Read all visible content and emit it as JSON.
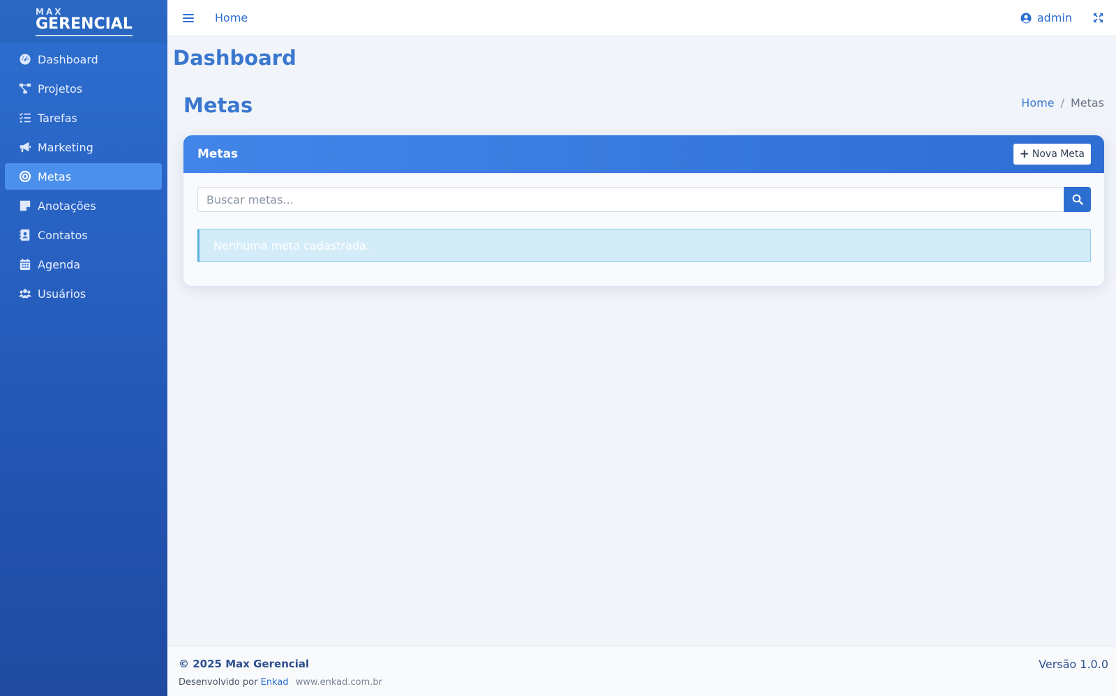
{
  "brand": {
    "top": "MAX",
    "main": "GERENCIAL"
  },
  "sidebar": {
    "items": [
      {
        "label": "Dashboard",
        "icon": "dashboard-gauge-icon"
      },
      {
        "label": "Projetos",
        "icon": "project-diagram-icon"
      },
      {
        "label": "Tarefas",
        "icon": "tasks-list-icon"
      },
      {
        "label": "Marketing",
        "icon": "bullhorn-icon"
      },
      {
        "label": "Metas",
        "icon": "target-icon",
        "active": true
      },
      {
        "label": "Anotações",
        "icon": "sticky-note-icon"
      },
      {
        "label": "Contatos",
        "icon": "address-book-icon"
      },
      {
        "label": "Agenda",
        "icon": "calendar-icon"
      },
      {
        "label": "Usuários",
        "icon": "users-icon"
      }
    ]
  },
  "topbar": {
    "home": "Home",
    "user": "admin"
  },
  "page": {
    "title": "Dashboard",
    "section_title": "Metas"
  },
  "breadcrumb": {
    "home": "Home",
    "separator": "/",
    "current": "Metas"
  },
  "card": {
    "title": "Metas",
    "new_button": "Nova Meta",
    "new_button_icon": "+",
    "search_placeholder": "Buscar metas...",
    "empty_message": "Nenhuma meta cadastrada."
  },
  "footer": {
    "copyright": "© 2025 Max Gerencial",
    "developed_by": "Desenvolvido por",
    "developer": "Enkad",
    "developer_url": "www.enkad.com.br",
    "version": "Versão 1.0.0"
  },
  "colors": {
    "accent": "#2d6fd0",
    "sidebar_active": "#4a90ec",
    "alert_bg": "#d3ecf8"
  }
}
